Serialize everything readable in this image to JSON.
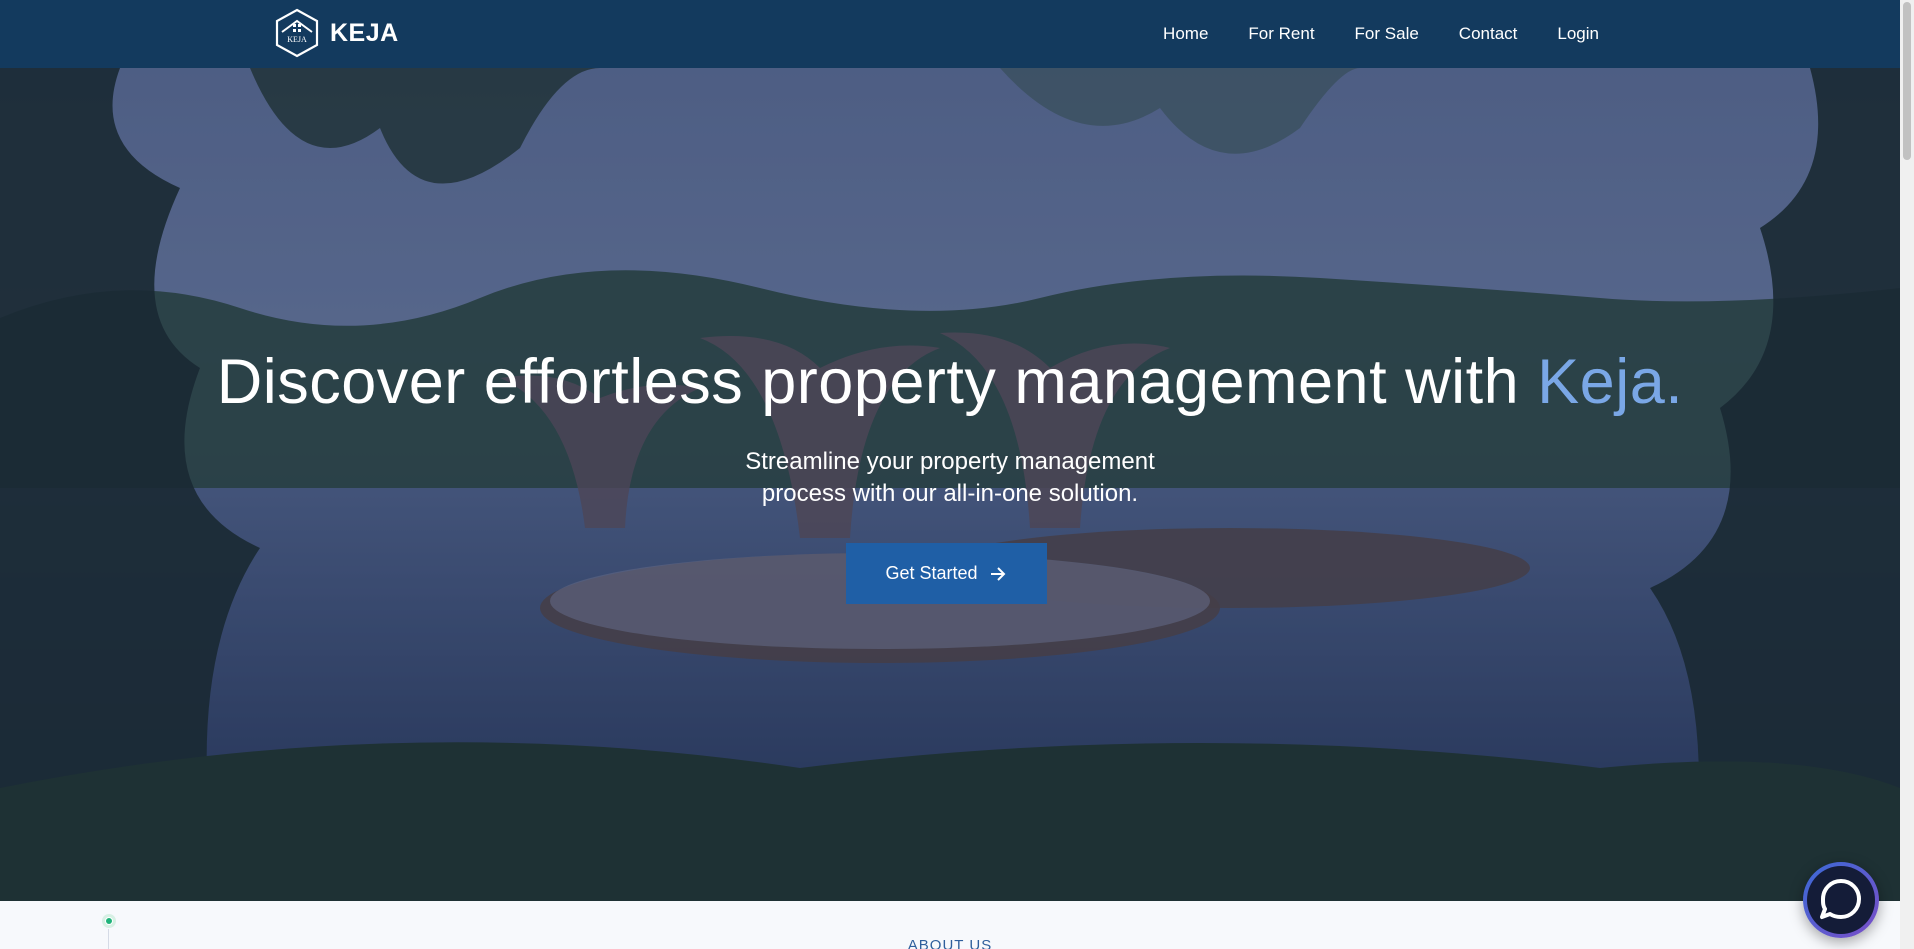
{
  "nav": {
    "brand": "KEJA",
    "logo_text": "KEJA",
    "links": [
      "Home",
      "For Rent",
      "For Sale",
      "Contact",
      "Login"
    ]
  },
  "hero": {
    "title_main": "Discover effortless property management with",
    "title_accent": "Keja.",
    "subtitle": "Streamline your property management process with our all-in-one solution.",
    "cta_label": "Get Started",
    "cta_icon": "arrow-right-icon"
  },
  "about": {
    "label": "ABOUT US"
  },
  "chat": {
    "icon": "chat-bubble-icon"
  },
  "colors": {
    "navbar": "#133a5e",
    "accent": "#7aa7e6",
    "cta": "#1f5fa6",
    "about_label": "#2f5f9c"
  }
}
